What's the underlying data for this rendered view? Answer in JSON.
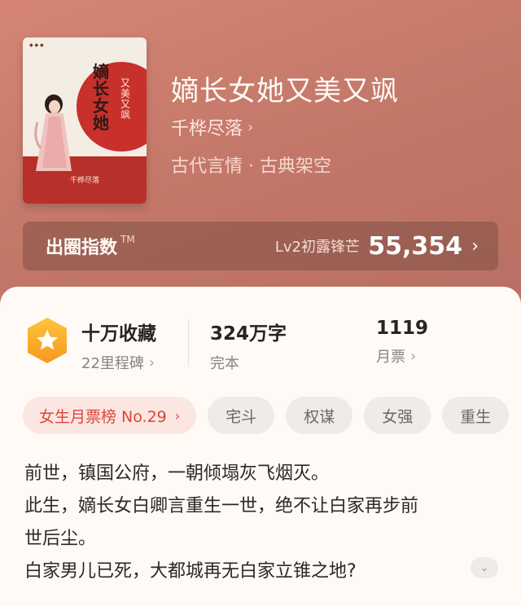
{
  "book": {
    "title": "嫡长女她又美又飒",
    "author": "千桦尽落",
    "genre": "古代言情 · 古典架空",
    "cover": {
      "title_chars": "嫡长女她",
      "subtitle_chars": "又美又飒",
      "author_line": "千桦尽落"
    }
  },
  "index_bar": {
    "label": "出圈指数",
    "trademark": "TM",
    "level": "Lv2初露锋芒",
    "value": "55,354"
  },
  "stats": {
    "favorites": {
      "main": "十万收藏",
      "sub": "22里程碑"
    },
    "words": {
      "main": "324万字",
      "sub": "完本"
    },
    "tickets": {
      "main": "1119",
      "sub": "月票"
    }
  },
  "tags": {
    "rank": "女生月票榜 No.29",
    "items": [
      "宅斗",
      "权谋",
      "女强",
      "重生"
    ]
  },
  "synopsis": {
    "line1": "前世，镇国公府，一朝倾塌灰飞烟灭。",
    "line2": "此生，嫡长女白卿言重生一世，绝不让白家再步前",
    "line3": "世后尘。",
    "line4": "白家男儿已死，大都城再无白家立锥之地?"
  },
  "colors": {
    "header_bg": "#c47668",
    "sheet_bg": "#fffaf6",
    "accent_red": "#e0433a",
    "badge_orange": "#f6a623"
  },
  "icons": {
    "chevron": "chevron-right-icon",
    "badge": "star-badge-icon",
    "expand": "chevron-down-icon"
  }
}
